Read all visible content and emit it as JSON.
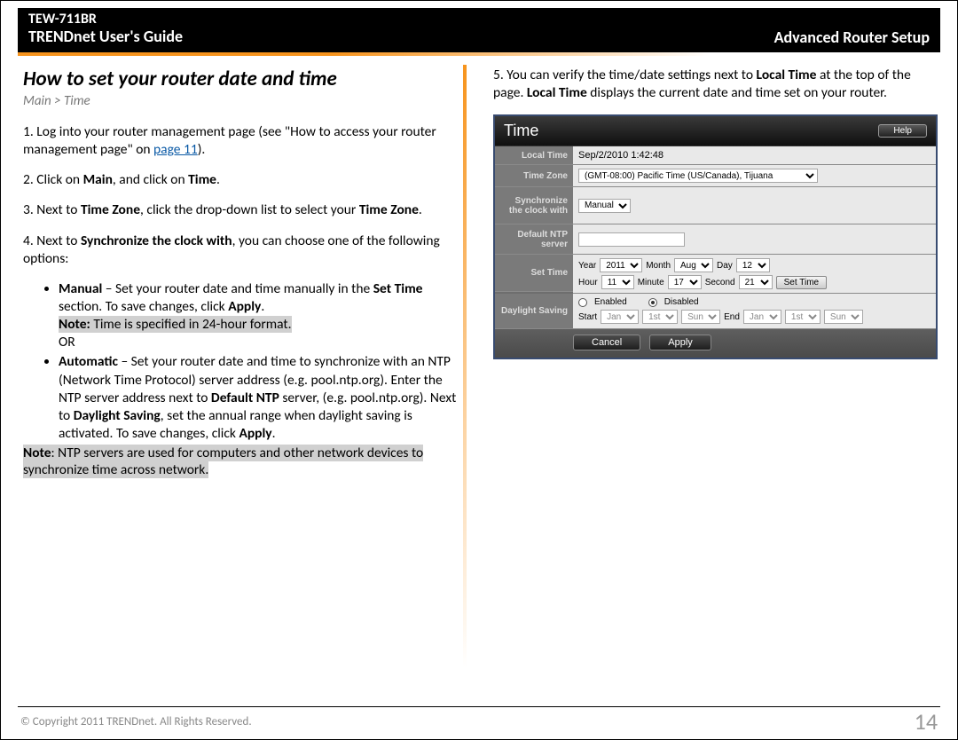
{
  "header": {
    "model": "TEW-711BR",
    "guide_title": "TRENDnet User's Guide",
    "section_name": "Advanced Router Setup"
  },
  "left": {
    "title": "How to set your router date and time",
    "breadcrumb": "Main > Time",
    "step1_pre": "1. Log into your router management page (see \"How to access your router management page\" on ",
    "step1_link": "page 11",
    "step1_post": ").",
    "step2_pre": "2. Click on ",
    "step2_b1": "Main",
    "step2_mid": ", and click on ",
    "step2_b2": "Time",
    "step2_post": ".",
    "step3_pre": "3. Next to ",
    "step3_b1": "Time Zone",
    "step3_mid": ", click the drop-down list to select your ",
    "step3_b2": "Time Zone",
    "step3_post": ".",
    "step4_pre": "4. Next to ",
    "step4_b1": "Synchronize the clock with",
    "step4_post": ", you can choose one of the following options:",
    "bullet_manual_b": "Manual",
    "bullet_manual_1": " – Set your router date and time manually in the ",
    "bullet_manual_b2": "Set Time",
    "bullet_manual_2": " section. To save changes, click ",
    "bullet_manual_b3": "Apply",
    "bullet_manual_3": ".",
    "note1_b": "Note:",
    "note1_text": " Time is specified in 24-hour format.",
    "or_text": "OR",
    "bullet_auto_b": "Automatic",
    "bullet_auto_1": " – Set your router date and time to synchronize with an NTP (Network Time Protocol) server address (e.g. pool.ntp.org). Enter the NTP server address next to ",
    "bullet_auto_b2": "Default NTP",
    "bullet_auto_2": " server, (e.g. pool.ntp.org). Next to ",
    "bullet_auto_b3": "Daylight Saving",
    "bullet_auto_3": ", set the annual range when daylight saving is activated. To save changes, click ",
    "bullet_auto_b4": "Apply",
    "bullet_auto_4": ".",
    "note2_b": "Note",
    "note2_text": ":  NTP servers are used for computers and other network devices to synchronize time across network."
  },
  "right": {
    "step5_pre": "5. You can verify the time/date settings next to ",
    "step5_b1": "Local Time",
    "step5_mid": " at the top of the page. ",
    "step5_b2": "Local Time",
    "step5_post": " displays the current date and time set on your router."
  },
  "router": {
    "panel_title": "Time",
    "help_label": "Help",
    "rows": {
      "local_time_label": "Local Time",
      "local_time_value": "Sep/2/2010 1:42:48",
      "time_zone_label": "Time Zone",
      "time_zone_value": "(GMT-08:00) Pacific Time (US/Canada), Tijuana",
      "sync_label": "Synchronize the clock with",
      "sync_value": "Manual",
      "ntp_label": "Default NTP server",
      "ntp_value": "",
      "set_time_label": "Set Time",
      "year_lbl": "Year",
      "year_val": "2011",
      "month_lbl": "Month",
      "month_val": "Aug",
      "day_lbl": "Day",
      "day_val": "12",
      "hour_lbl": "Hour",
      "hour_val": "11",
      "minute_lbl": "Minute",
      "minute_val": "17",
      "second_lbl": "Second",
      "second_val": "21",
      "set_time_btn": "Set Time",
      "daylight_label": "Daylight Saving",
      "enabled_lbl": "Enabled",
      "disabled_lbl": "Disabled",
      "start_lbl": "Start",
      "end_lbl": "End",
      "ds_month": "Jan",
      "ds_week": "1st",
      "ds_day": "Sun"
    },
    "cancel_btn": "Cancel",
    "apply_btn": "Apply"
  },
  "footer": {
    "copyright": "© Copyright 2011 TRENDnet. All Rights Reserved.",
    "page_number": "14"
  }
}
